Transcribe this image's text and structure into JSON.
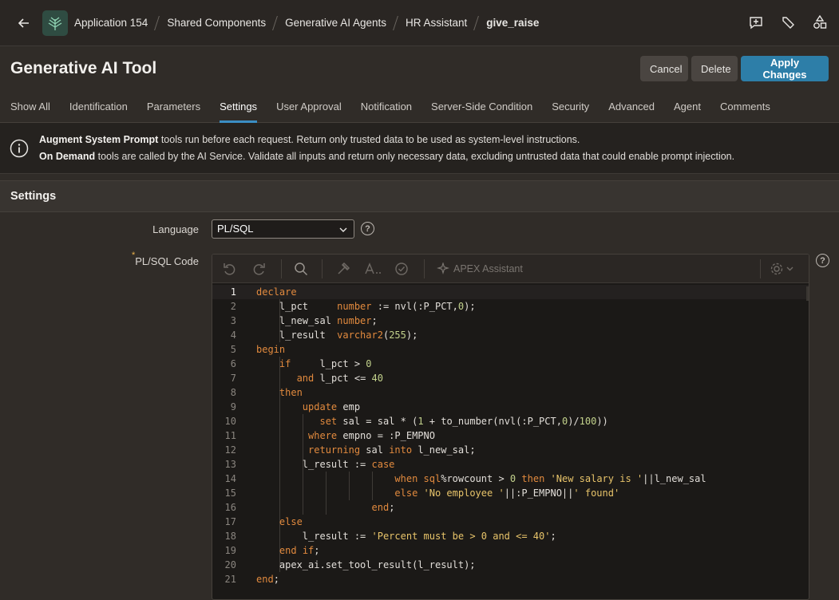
{
  "nav": {
    "breadcrumbs": [
      {
        "label": "Application 154"
      },
      {
        "label": "Shared Components"
      },
      {
        "label": "Generative AI Agents"
      },
      {
        "label": "HR Assistant"
      },
      {
        "label": "give_raise"
      }
    ]
  },
  "header": {
    "title": "Generative AI Tool",
    "cancel_label": "Cancel",
    "delete_label": "Delete",
    "apply_label": "Apply Changes"
  },
  "tabs": [
    {
      "label": "Show All"
    },
    {
      "label": "Identification"
    },
    {
      "label": "Parameters"
    },
    {
      "label": "Settings",
      "active": true
    },
    {
      "label": "User Approval"
    },
    {
      "label": "Notification"
    },
    {
      "label": "Server-Side Condition"
    },
    {
      "label": "Security"
    },
    {
      "label": "Advanced"
    },
    {
      "label": "Agent"
    },
    {
      "label": "Comments"
    }
  ],
  "banner": {
    "line1_bold": "Augment System Prompt",
    "line1_text": " tools run before each request. Return only trusted data to be used as system-level instructions.",
    "line2_bold": "On Demand",
    "line2_text": " tools are called by the AI Service. Validate all inputs and return only necessary data, excluding untrusted data that could enable prompt injection."
  },
  "settings": {
    "section_title": "Settings",
    "language_label": "Language",
    "language_value": "PL/SQL",
    "code_label": "PL/SQL Code",
    "required_marker": "*",
    "help_glyph": "?"
  },
  "editor": {
    "assistant_label": "APEX Assistant",
    "lines": [
      "declare",
      "    l_pct     number := nvl(:P_PCT,0);",
      "    l_new_sal number;",
      "    l_result  varchar2(255);",
      "begin",
      "    if     l_pct > 0",
      "       and l_pct <= 40",
      "    then",
      "        update emp",
      "           set sal = sal * (1 + to_number(nvl(:P_PCT,0)/100))",
      "         where empno = :P_EMPNO",
      "         returning sal into l_new_sal;",
      "        l_result := case",
      "                        when sql%rowcount > 0 then 'New salary is '||l_new_sal",
      "                        else 'No employee '||:P_EMPNO||' found'",
      "                    end;",
      "    else",
      "        l_result := 'Percent must be > 0 and <= 40';",
      "    end if;",
      "    apex_ai.set_tool_result(l_result);",
      "end;"
    ]
  },
  "colors": {
    "accent": "#2d7ea8",
    "keyword": "#e28a3e",
    "string": "#e8c46a",
    "number": "#c3d28c"
  }
}
